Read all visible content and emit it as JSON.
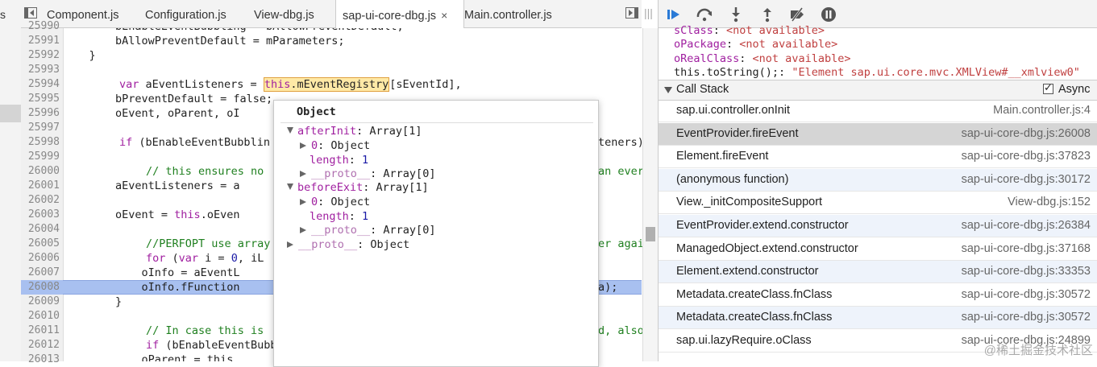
{
  "left_strip": {
    "text": "s"
  },
  "tabs": [
    {
      "label": "Component.js"
    },
    {
      "label": "Configuration.js"
    },
    {
      "label": "View-dbg.js"
    },
    {
      "label": "sap-ui-core-dbg.js",
      "close": "×"
    },
    {
      "label": "Main.controller.js"
    }
  ],
  "code_lines": [
    {
      "num": "25990",
      "text": "        bEnableEventBubbling = bAllowPreventDefault;"
    },
    {
      "num": "25991",
      "text": "        bAllowPreventDefault = mParameters;"
    },
    {
      "num": "25992",
      "text": "    }"
    },
    {
      "num": "25993",
      "text": ""
    },
    {
      "num": "25994",
      "text": ""
    },
    {
      "num": "25995",
      "text": "        bPreventDefault = false;"
    },
    {
      "num": "25996",
      "text": "        oEvent, oParent, oI"
    },
    {
      "num": "25997",
      "text": ""
    },
    {
      "num": "25998",
      "text": ""
    },
    {
      "num": "25999",
      "text": ""
    },
    {
      "num": "26000",
      "text": ""
    },
    {
      "num": "26001",
      "text": "        aEventListeners = a"
    },
    {
      "num": "26002",
      "text": ""
    },
    {
      "num": "26003",
      "text": ""
    },
    {
      "num": "26004",
      "text": ""
    },
    {
      "num": "26005",
      "text": ""
    },
    {
      "num": "26006",
      "text": ""
    },
    {
      "num": "26007",
      "text": "            oInfo = aEventL"
    },
    {
      "num": "26008",
      "text": "            oInfo.fFunction"
    },
    {
      "num": "26009",
      "text": "        }"
    },
    {
      "num": "26010",
      "text": ""
    },
    {
      "num": "26011",
      "text": ""
    },
    {
      "num": "26012",
      "text": ""
    },
    {
      "num": "26013",
      "text": "            oParent = this"
    }
  ],
  "code_tokens": {
    "l25994_var": "var",
    "l25994_pre": " aEventListeners = ",
    "l25994_this": "this",
    "l25994_prop": ".mEventRegistry",
    "l25994_post": "[sEventId],",
    "l25998_if": "if",
    "l25998_rest": " (bEnableEventBubblin",
    "l25998_tail": "teners)",
    "l26000_comment": "// this ensures no",
    "l26000_tail": "an ever",
    "l26003_pre": "        oEvent = ",
    "l26003_this": "this",
    "l26003_post": ".oEven",
    "l26005_comment": "//PERFOPT use array",
    "l26005_tail": "er agai",
    "l26006_for": "for",
    "l26006_paren": " (",
    "l26006_var": "var",
    "l26006_mid": " i = ",
    "l26006_zero": "0",
    "l26006_end": ", iL",
    "l26008_tail": "a);",
    "l26011_comment": "// In case this is",
    "l26011_tail": "d, also",
    "l26012_if": "if",
    "l26012_rest": " (bEnableEventBubb"
  },
  "popover": {
    "title": "Object",
    "rows": [
      {
        "key": "afterInit",
        "sep": ": ",
        "value": "Array[1]"
      },
      {
        "key": "0",
        "sep": ": ",
        "value": "Object"
      },
      {
        "key": "length",
        "sep": ": ",
        "value": "1"
      },
      {
        "key": "__proto__",
        "sep": ": ",
        "value": "Array[0]"
      },
      {
        "key": "beforeExit",
        "sep": ": ",
        "value": "Array[1]"
      },
      {
        "key": "0",
        "sep": ": ",
        "value": "Object"
      },
      {
        "key": "length",
        "sep": ": ",
        "value": "1"
      },
      {
        "key": "__proto__",
        "sep": ": ",
        "value": "Array[0]"
      },
      {
        "key": "__proto__",
        "sep": ": ",
        "value": "Object"
      }
    ]
  },
  "scope": [
    {
      "key": "sClass",
      "sep": ": ",
      "value": "<not available>"
    },
    {
      "key": "oPackage",
      "sep": ": ",
      "value": "<not available>"
    },
    {
      "key": "oRealClass",
      "sep": ": ",
      "value": "<not available>"
    },
    {
      "key": "this.toString();",
      "sep": ": ",
      "value": "\"Element sap.ui.core.mvc.XMLView#__xmlview0\""
    }
  ],
  "call_stack": {
    "title": "Call Stack",
    "async_label": "Async",
    "async_checked": true,
    "frames": [
      {
        "fn": "sap.ui.controller.onInit",
        "loc": "Main.controller.js:4"
      },
      {
        "fn": "EventProvider.fireEvent",
        "loc": "sap-ui-core-dbg.js:26008"
      },
      {
        "fn": "Element.fireEvent",
        "loc": "sap-ui-core-dbg.js:37823"
      },
      {
        "fn": "(anonymous function)",
        "loc": "sap-ui-core-dbg.js:30172"
      },
      {
        "fn": "View._initCompositeSupport",
        "loc": "View-dbg.js:152"
      },
      {
        "fn": "EventProvider.extend.constructor",
        "loc": "sap-ui-core-dbg.js:26384"
      },
      {
        "fn": "ManagedObject.extend.constructor",
        "loc": "sap-ui-core-dbg.js:37168"
      },
      {
        "fn": "Element.extend.constructor",
        "loc": "sap-ui-core-dbg.js:33353"
      },
      {
        "fn": "Metadata.createClass.fnClass",
        "loc": "sap-ui-core-dbg.js:30572"
      },
      {
        "fn": "Metadata.createClass.fnClass",
        "loc": "sap-ui-core-dbg.js:30572"
      },
      {
        "fn": "sap.ui.lazyRequire.oClass",
        "loc": "sap-ui-core-dbg.js:24899"
      }
    ]
  },
  "watermark": "@稀土掘金技术社区",
  "colors": {
    "keyword": "#a020a0",
    "comment": "#208020",
    "exec_line": "#a8c0f0",
    "selected_frame": "#d5d5d5"
  },
  "icons": [
    "resume-icon",
    "step-over-icon",
    "step-into-icon",
    "step-out-icon",
    "deactivate-breakpoints-icon",
    "pause-on-exceptions-icon"
  ]
}
